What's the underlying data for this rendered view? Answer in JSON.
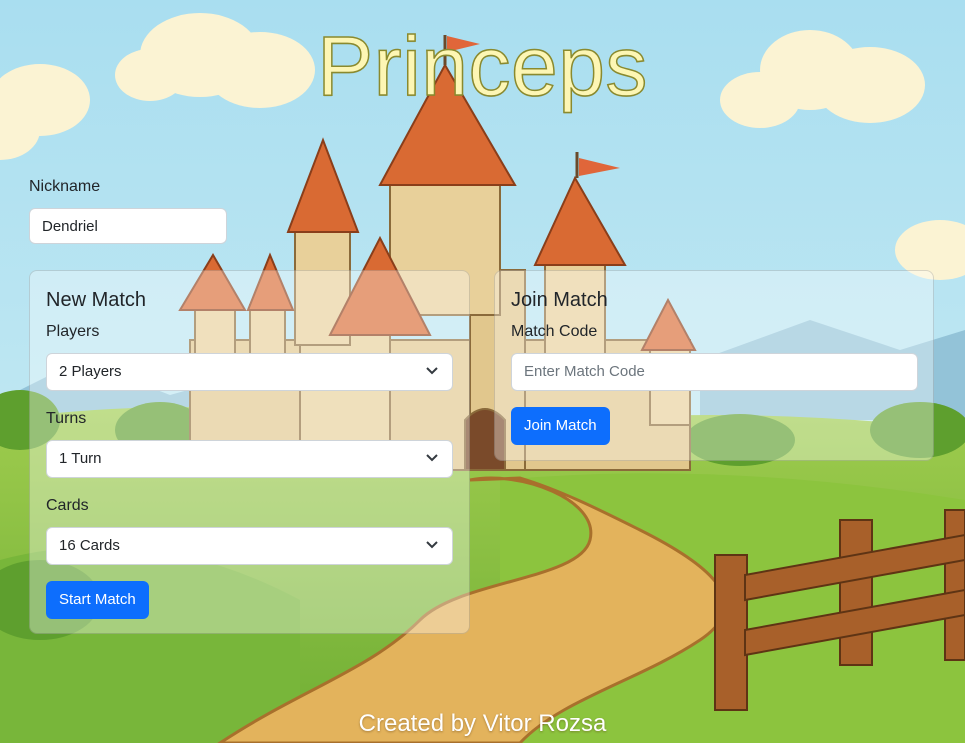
{
  "app": {
    "title": "Princeps",
    "footer": "Created by Vitor Rozsa"
  },
  "nickname": {
    "label": "Nickname",
    "value": "Dendriel"
  },
  "new_match": {
    "title": "New Match",
    "players": {
      "label": "Players",
      "selected": "2 Players"
    },
    "turns": {
      "label": "Turns",
      "selected": "1 Turn"
    },
    "cards": {
      "label": "Cards",
      "selected": "16 Cards"
    },
    "start_label": "Start Match"
  },
  "join_match": {
    "title": "Join Match",
    "code_label": "Match Code",
    "code_placeholder": "Enter Match Code",
    "join_label": "Join Match"
  },
  "colors": {
    "primary": "#0d6efd",
    "title_fill": "#fdf6b4",
    "sky": "#bde6f2",
    "grass": "#86bf3f",
    "path": "#e3b35c",
    "roof": "#d96a33",
    "stone": "#e1c78d"
  }
}
